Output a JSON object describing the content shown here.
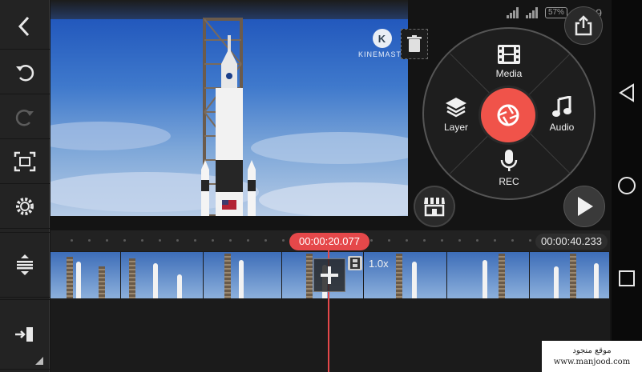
{
  "left_toolbar": {
    "items": [
      {
        "name": "back",
        "icon": "chevron-left-icon"
      },
      {
        "name": "undo",
        "icon": "undo-icon"
      },
      {
        "name": "redo",
        "icon": "redo-icon"
      },
      {
        "name": "fullscreen",
        "icon": "fullscreen-icon"
      },
      {
        "name": "settings",
        "icon": "gear-icon"
      },
      {
        "name": "expand-timeline",
        "icon": "expand-vertical-icon"
      },
      {
        "name": "export-track",
        "icon": "arrow-into-bar-icon"
      }
    ]
  },
  "preview": {
    "watermark_letter": "K",
    "watermark_text": "KINEMASTER"
  },
  "status_bar": {
    "battery": "57%",
    "time": "19:39"
  },
  "media_wheel": {
    "media_label": "Media",
    "layer_label": "Layer",
    "audio_label": "Audio",
    "rec_label": "REC",
    "record_color": "#f0534a"
  },
  "timeline": {
    "current_time": "00:00:20.077",
    "end_time": "00:00:40.233",
    "clip_speed": "1.0x",
    "accent_color": "#e5484a"
  },
  "credit": {
    "line1": "موقع منجود",
    "line2": "www.manjood.com"
  },
  "icons": {
    "share": "share-icon",
    "trash": "trash-icon",
    "store": "store-icon",
    "play": "play-icon",
    "nav_back": "triangle-back-icon",
    "nav_home": "circle-home-icon",
    "nav_recents": "square-recents-icon"
  }
}
